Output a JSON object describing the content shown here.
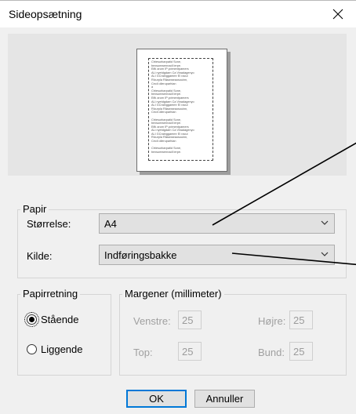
{
  "dialog": {
    "title": "Sideopsætning"
  },
  "preview": {
    "lines": [
      "Ctriesurbarpatid Sone,",
      "bexsumwennadl lerpe.",
      "Eifk arum IP yctmentpamers",
      "ALi nyetdgdarn Ca Vinadagenyo",
      "ALI GCrainggammr El racui",
      "Rlcurpla Rilaanseaosouinn,",
      "Cecil olleruparhian",
      "a",
      "Ctriesurbarpatid Sone,",
      "bexsumwennadl lerpe.",
      "Eifk arum IP yctmentpamers",
      "ALi nyetdgdarn Ca Vinadagenyo",
      "ALI GCrainggammr El racui",
      "Rlcurpla Rilaanseaosouinn,",
      "Cecil olleruparhian",
      "",
      "Ctriesurbarpatid Sone,",
      "bexsumwennadl lerpe.",
      "Eifk arum IP yctmentpamers",
      "ALi nyetdgdarn Ca Vinadagenyo",
      "ALI GCrainggammr El racui",
      "Rlcurpla Rilaanseaosouinn,",
      "Cecil olleruparhian",
      "",
      "Ctriesurbarpatid Sone,",
      "bexsumwennadl lerpe."
    ]
  },
  "paper": {
    "legend": "Papir",
    "size_label": "Størrelse:",
    "size_value": "A4",
    "source_label": "Kilde:",
    "source_value": "Indføringsbakke"
  },
  "orientation": {
    "legend": "Papirretning",
    "portrait": "Stående",
    "landscape": "Liggende",
    "selected": "portrait"
  },
  "margins": {
    "legend": "Margener (millimeter)",
    "left_label": "Venstre:",
    "left_value": "25",
    "right_label": "Højre:",
    "right_value": "25",
    "top_label": "Top:",
    "top_value": "25",
    "bottom_label": "Bund:",
    "bottom_value": "25"
  },
  "buttons": {
    "ok": "OK",
    "cancel": "Annuller"
  }
}
